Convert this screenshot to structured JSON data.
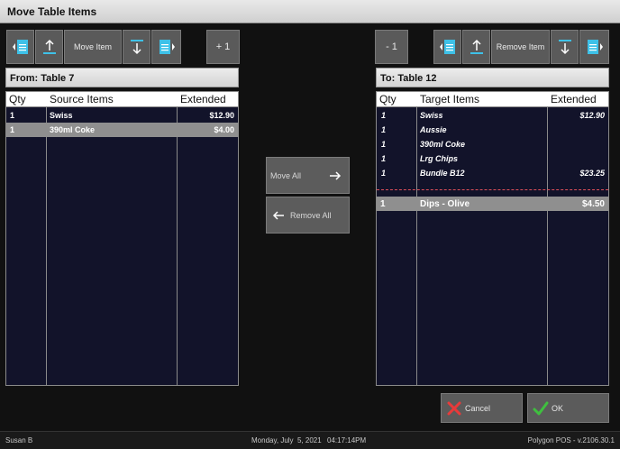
{
  "window": {
    "title": "Move Table Items"
  },
  "left_toolbar": {
    "move_label": "Move Item",
    "plus_label": "+ 1"
  },
  "right_toolbar": {
    "remove_label": "Remove Item",
    "minus_label": "- 1"
  },
  "source": {
    "header": "From: Table 7",
    "columns": [
      "Qty",
      "Source Items",
      "Extended"
    ],
    "rows": [
      {
        "qty": "1",
        "item": "Swiss",
        "ext": "$12.90",
        "selected": false
      },
      {
        "qty": "1",
        "item": "390ml Coke",
        "ext": "$4.00",
        "selected": true
      }
    ]
  },
  "target": {
    "header": "To: Table 12",
    "columns": [
      "Qty",
      "Target Items",
      "Extended"
    ],
    "rows": [
      {
        "qty": "1",
        "item": "Swiss",
        "ext": "$12.90"
      },
      {
        "qty": "1",
        "item": "Aussie",
        "ext": ""
      },
      {
        "qty": "1",
        "item": "390ml Coke",
        "ext": ""
      },
      {
        "qty": "1",
        "item": "Lrg Chips",
        "ext": ""
      },
      {
        "qty": "1",
        "item": "Bundle B12",
        "ext": "$23.25"
      }
    ],
    "new_rows": [
      {
        "qty": "1",
        "item": "Dips - Olive",
        "ext": "$4.50"
      }
    ]
  },
  "middle": {
    "move_all": "Move All",
    "remove_all": "Remove All"
  },
  "actions": {
    "cancel": "Cancel",
    "ok": "OK"
  },
  "status_bar": {
    "user": "Susan B",
    "date": "Monday, July  5, 2021",
    "time": "04:17:14PM",
    "version": "Polygon POS - v.2106.30.1"
  },
  "colors": {
    "accent_doc": "#3ec1e8",
    "sep_line": "#e0505a",
    "cancel_x": "#e83a3a",
    "ok_check": "#3fbf3f"
  }
}
